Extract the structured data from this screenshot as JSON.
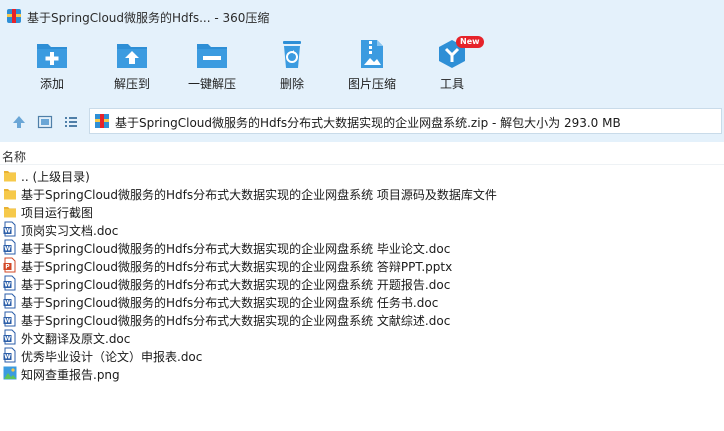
{
  "window": {
    "title": "基于SpringCloud微服务的Hdfs... - 360压缩"
  },
  "toolbar": {
    "add": "添加",
    "extract_to": "解压到",
    "one_click_extract": "一键解压",
    "delete": "删除",
    "image_compress": "图片压缩",
    "tools": "工具",
    "tools_badge": "New"
  },
  "address": {
    "path": "基于SpringCloud微服务的Hdfs分布式大数据实现的企业网盘系统.zip - 解包大小为 293.0 MB"
  },
  "list": {
    "column_name": "名称",
    "items": [
      {
        "name": ".. (上级目录)",
        "type": "folder"
      },
      {
        "name": "基于SpringCloud微服务的Hdfs分布式大数据实现的企业网盘系统 项目源码及数据库文件",
        "type": "folder"
      },
      {
        "name": "项目运行截图",
        "type": "folder"
      },
      {
        "name": "顶岗实习文档.doc",
        "type": "doc"
      },
      {
        "name": "基于SpringCloud微服务的Hdfs分布式大数据实现的企业网盘系统 毕业论文.doc",
        "type": "doc"
      },
      {
        "name": "基于SpringCloud微服务的Hdfs分布式大数据实现的企业网盘系统 答辩PPT.pptx",
        "type": "pptx"
      },
      {
        "name": "基于SpringCloud微服务的Hdfs分布式大数据实现的企业网盘系统 开题报告.doc",
        "type": "doc"
      },
      {
        "name": "基于SpringCloud微服务的Hdfs分布式大数据实现的企业网盘系统 任务书.doc",
        "type": "doc"
      },
      {
        "name": "基于SpringCloud微服务的Hdfs分布式大数据实现的企业网盘系统 文献综述.doc",
        "type": "doc"
      },
      {
        "name": "外文翻译及原文.doc",
        "type": "doc"
      },
      {
        "name": "优秀毕业设计（论文）申报表.doc",
        "type": "doc"
      },
      {
        "name": "知网查重报告.png",
        "type": "png"
      }
    ]
  },
  "colors": {
    "accent": "#2e8fd6",
    "toolbar_bg": "#e4f1fb",
    "folder": "#f6c94a",
    "ppt": "#d24726",
    "badge": "#e6232a"
  }
}
